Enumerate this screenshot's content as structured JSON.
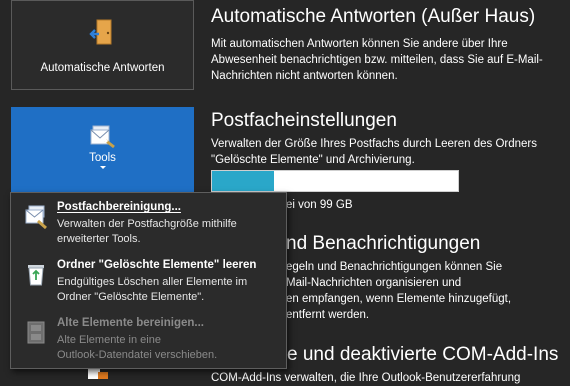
{
  "tiles": {
    "auto_reply": {
      "label": "Automatische Antworten"
    },
    "tools": {
      "label": "Tools"
    }
  },
  "sections": {
    "auto_reply": {
      "title": "Automatische Antworten (Außer Haus)",
      "desc": [
        "Mit automatischen Antworten können Sie andere über Ihre",
        "Abwesenheit benachrichtigen bzw. mitteilen, dass Sie auf E-Mail-",
        "Nachrichten nicht antworten können."
      ]
    },
    "mailbox": {
      "title": "Postfacheinstellungen",
      "desc": [
        "Verwalten der Größe Ihres Postfachs durch Leeren des Ordners",
        "\"Gelöschte Elemente\" und Archivierung."
      ],
      "usage_fraction": 0.25,
      "usage_text": "ei von 99 GB"
    },
    "rules": {
      "title": "nd Benachrichtigungen",
      "desc": [
        "egeln und Benachrichtigungen können Sie",
        "Mail-Nachrichten organisieren und",
        "en empfangen, wenn Elemente hinzugefügt,",
        "entfernt werden."
      ]
    },
    "addins": {
      "title": "e und deaktivierte COM-Add-Ins",
      "desc": [
        "COM-Add-Ins verwalten, die Ihre Outlook-Benutzererfahrung"
      ]
    }
  },
  "menu": {
    "items": [
      {
        "title": "Postfachbereinigung...",
        "desc": [
          "Verwalten der Postfachgröße mithilfe",
          "erweiterter Tools."
        ],
        "icon": "mailbox-cleanup-icon",
        "enabled": true
      },
      {
        "title": "Ordner \"Gelöschte Elemente\" leeren",
        "desc": [
          "Endgültiges Löschen aller Elemente im",
          "Ordner \"Gelöschte Elemente\"."
        ],
        "icon": "recycle-bin-icon",
        "enabled": true
      },
      {
        "title": "Alte Elemente bereinigen...",
        "desc": [
          "Alte Elemente in eine",
          "Outlook-Datendatei verschieben."
        ],
        "icon": "archive-cabinet-icon",
        "enabled": false
      }
    ]
  },
  "colors": {
    "background": "#262626",
    "tile_selected": "#1f6fc5",
    "progress_fill": "#2aa7c9"
  }
}
